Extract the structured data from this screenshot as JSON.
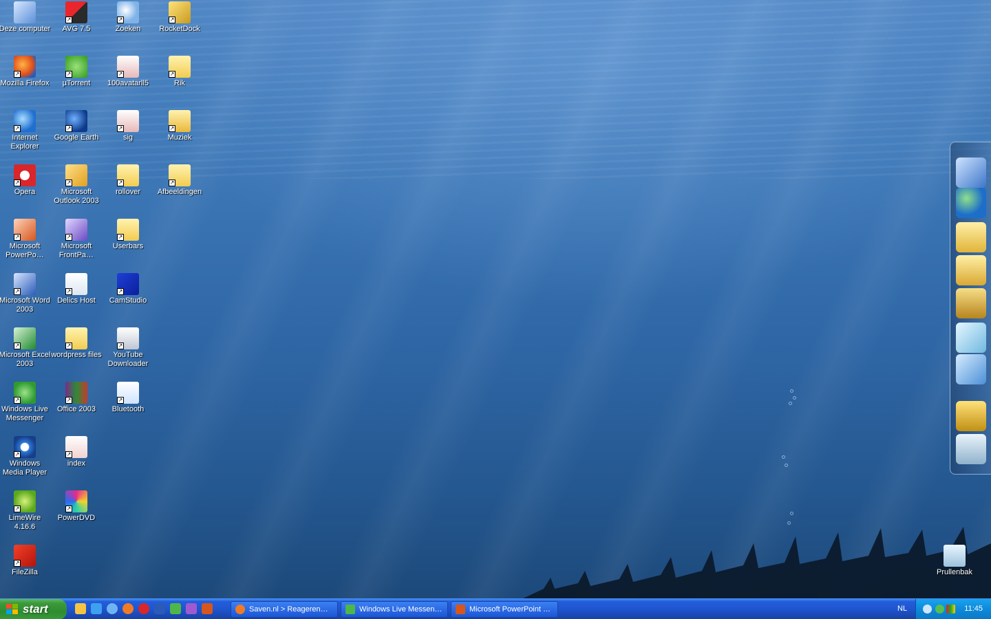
{
  "desktop": {
    "icons": [
      {
        "label": "Deze computer",
        "icon": "computer-icon"
      },
      {
        "label": "AVG 7.5",
        "icon": "avg-icon"
      },
      {
        "label": "Zoeken",
        "icon": "search-icon"
      },
      {
        "label": "RocketDock",
        "icon": "rocketdock-icon"
      },
      {
        "label": "Mozilla Firefox",
        "icon": "firefox-icon"
      },
      {
        "label": "µTorrent",
        "icon": "utorrent-icon"
      },
      {
        "label": "100avatarll5",
        "icon": "document-icon"
      },
      {
        "label": "Rik",
        "icon": "folder-icon"
      },
      {
        "label": "Internet Explorer",
        "icon": "ie-icon"
      },
      {
        "label": "Google Earth",
        "icon": "google-earth-icon"
      },
      {
        "label": "sig",
        "icon": "document-icon"
      },
      {
        "label": "Muziek",
        "icon": "music-folder-icon"
      },
      {
        "label": "Opera",
        "icon": "opera-icon"
      },
      {
        "label": "Microsoft Outlook 2003",
        "icon": "outlook-icon"
      },
      {
        "label": "rollover",
        "icon": "folder-icon"
      },
      {
        "label": "Afbeeldingen",
        "icon": "pictures-folder-icon"
      },
      {
        "label": "Microsoft PowerPo…",
        "icon": "powerpoint-icon"
      },
      {
        "label": "Microsoft FrontPa…",
        "icon": "frontpage-icon"
      },
      {
        "label": "Userbars",
        "icon": "folder-icon"
      },
      {
        "label": "Microsoft Word 2003",
        "icon": "word-icon"
      },
      {
        "label": "Delics Host",
        "icon": "text-file-icon"
      },
      {
        "label": "CamStudio",
        "icon": "camstudio-icon"
      },
      {
        "label": "Microsoft Excel 2003",
        "icon": "excel-icon"
      },
      {
        "label": "wordpress files",
        "icon": "folder-icon"
      },
      {
        "label": "YouTube Downloader",
        "icon": "youtube-downloader-icon"
      },
      {
        "label": "Windows Live Messenger",
        "icon": "messenger-icon"
      },
      {
        "label": "Office 2003",
        "icon": "archive-icon"
      },
      {
        "label": "Bluetooth",
        "icon": "bluetooth-icon"
      },
      {
        "label": "Windows Media Player",
        "icon": "media-player-icon"
      },
      {
        "label": "index",
        "icon": "opera-document-icon"
      },
      {
        "label": "LimeWire 4.16.6",
        "icon": "limewire-icon"
      },
      {
        "label": "PowerDVD",
        "icon": "powerdvd-icon"
      },
      {
        "label": "FileZilla",
        "icon": "filezilla-icon"
      },
      {
        "label": "Prullenbak",
        "icon": "recycle-bin-icon"
      }
    ]
  },
  "dock": {
    "items": [
      "computer-icon",
      "network-icon",
      "folder-icon",
      "music-folder-icon",
      "video-folder-icon",
      "notepad-icon",
      "control-panel-icon",
      "lock-icon",
      "trash-icon"
    ]
  },
  "taskbar": {
    "start_label": "start",
    "quick_launch": [
      "clock-icon",
      "ie-icon",
      "media-player-icon",
      "firefox-icon",
      "opera-icon",
      "word-icon",
      "messenger-icon",
      "camera-icon",
      "powerpoint-icon"
    ],
    "tasks": [
      {
        "label": "Saven.nl > Reageren…",
        "icon": "firefox-icon"
      },
      {
        "label": "Windows Live Messen…",
        "icon": "messenger-icon"
      },
      {
        "label": "Microsoft PowerPoint …",
        "icon": "powerpoint-icon"
      }
    ],
    "language": "NL",
    "clock": "11:45"
  }
}
